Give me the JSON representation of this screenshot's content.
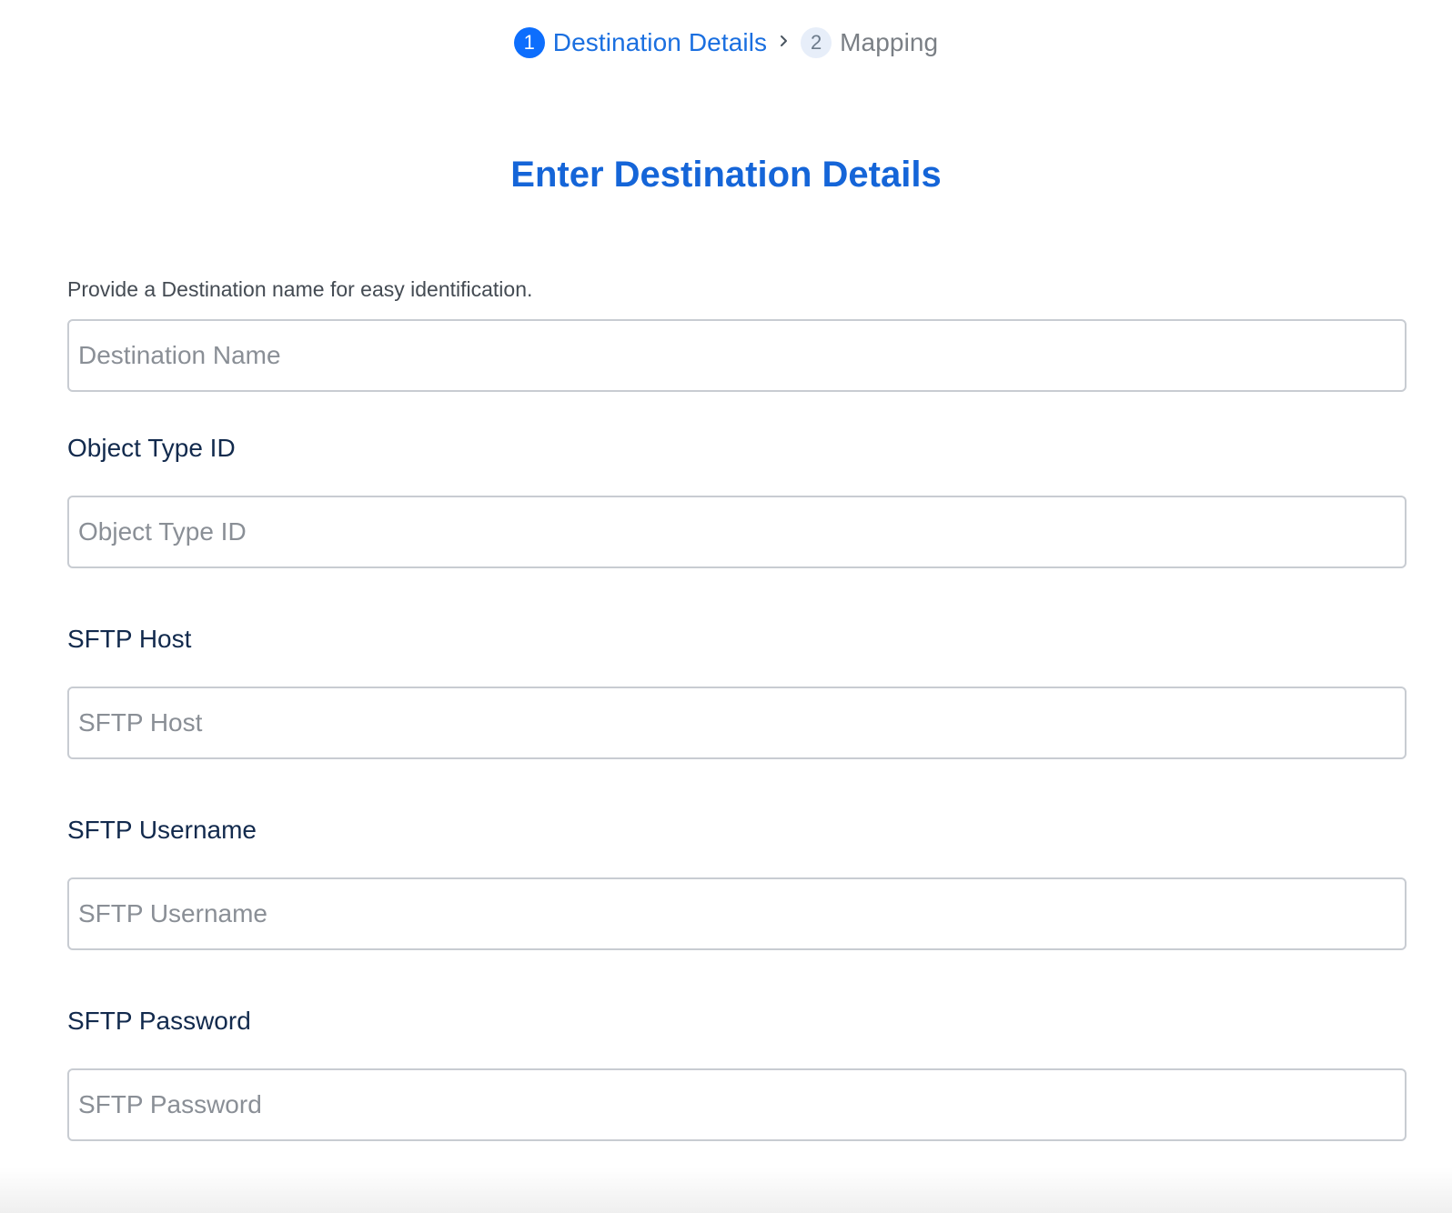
{
  "stepper": {
    "steps": [
      {
        "number": "1",
        "label": "Destination Details",
        "state": "active"
      },
      {
        "number": "2",
        "label": "Mapping",
        "state": "inactive"
      }
    ],
    "separator_icon": "chevron-right-icon"
  },
  "main": {
    "title": "Enter Destination Details",
    "helper_text": "Provide a Destination name for easy identification.",
    "fields": {
      "destination_name": {
        "placeholder": "Destination Name",
        "value": ""
      },
      "object_type_id": {
        "label": "Object Type ID",
        "placeholder": "Object Type ID",
        "value": ""
      },
      "sftp_host": {
        "label": "SFTP Host",
        "placeholder": "SFTP Host",
        "value": ""
      },
      "sftp_username": {
        "label": "SFTP Username",
        "placeholder": "SFTP Username",
        "value": ""
      },
      "sftp_password": {
        "label": "SFTP Password",
        "placeholder": "SFTP Password",
        "value": ""
      }
    }
  },
  "colors": {
    "accent": "#1a6fe0",
    "active_step_bg": "#0d6efd",
    "inactive_step_bg": "#e7eef9",
    "label_text": "#122a4d",
    "input_border": "#c8ccd2"
  }
}
